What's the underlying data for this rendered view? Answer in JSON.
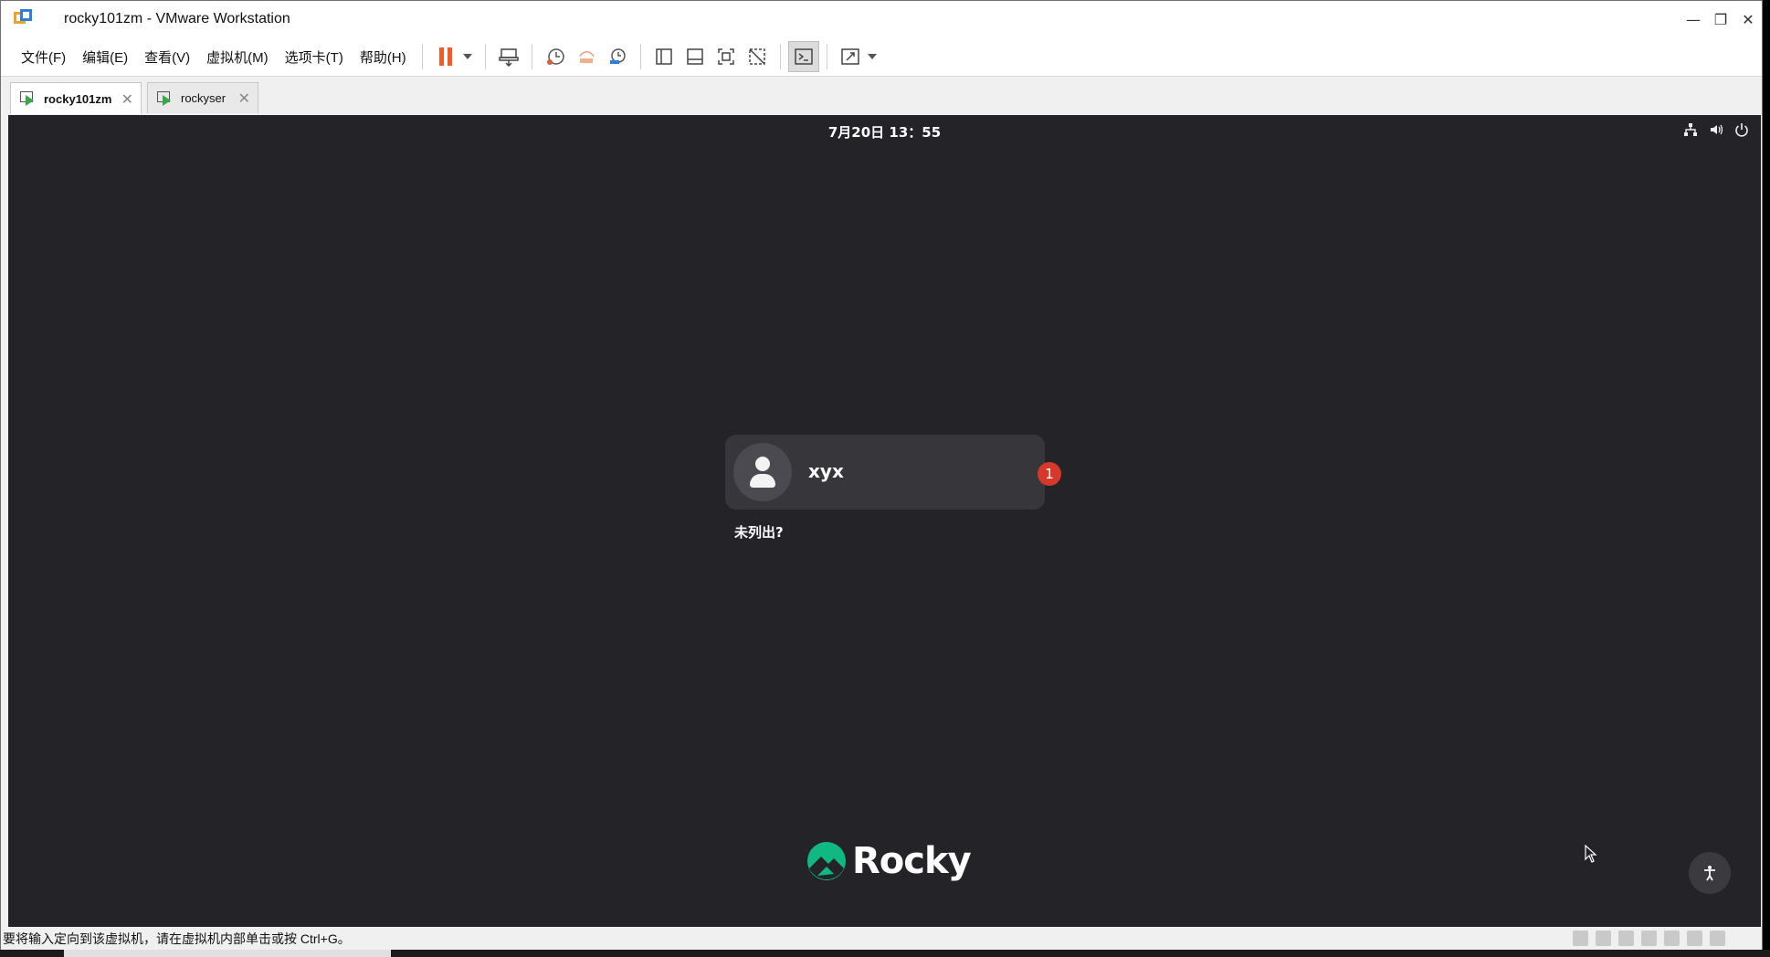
{
  "window": {
    "title": "rocky101zm - VMware Workstation"
  },
  "menu": [
    "文件(F)",
    "编辑(E)",
    "查看(V)",
    "虚拟机(M)",
    "选项卡(T)",
    "帮助(H)"
  ],
  "tabs": [
    {
      "label": "rocky101zm",
      "active": true
    },
    {
      "label": "rockyser",
      "active": false
    }
  ],
  "vm": {
    "clock": "7月20日  13：55",
    "user": {
      "name": "xyx",
      "badge_count": "1"
    },
    "not_listed": "未列出?",
    "logo_text": "Rocky"
  },
  "status": {
    "message": "要将输入定向到该虚拟机，请在虚拟机内部单击或按 Ctrl+G。"
  },
  "colors": {
    "accent_pause": "#f25a2a",
    "badge": "#d6382b",
    "logo_green": "#10b981",
    "vm_bg": "#232328"
  }
}
